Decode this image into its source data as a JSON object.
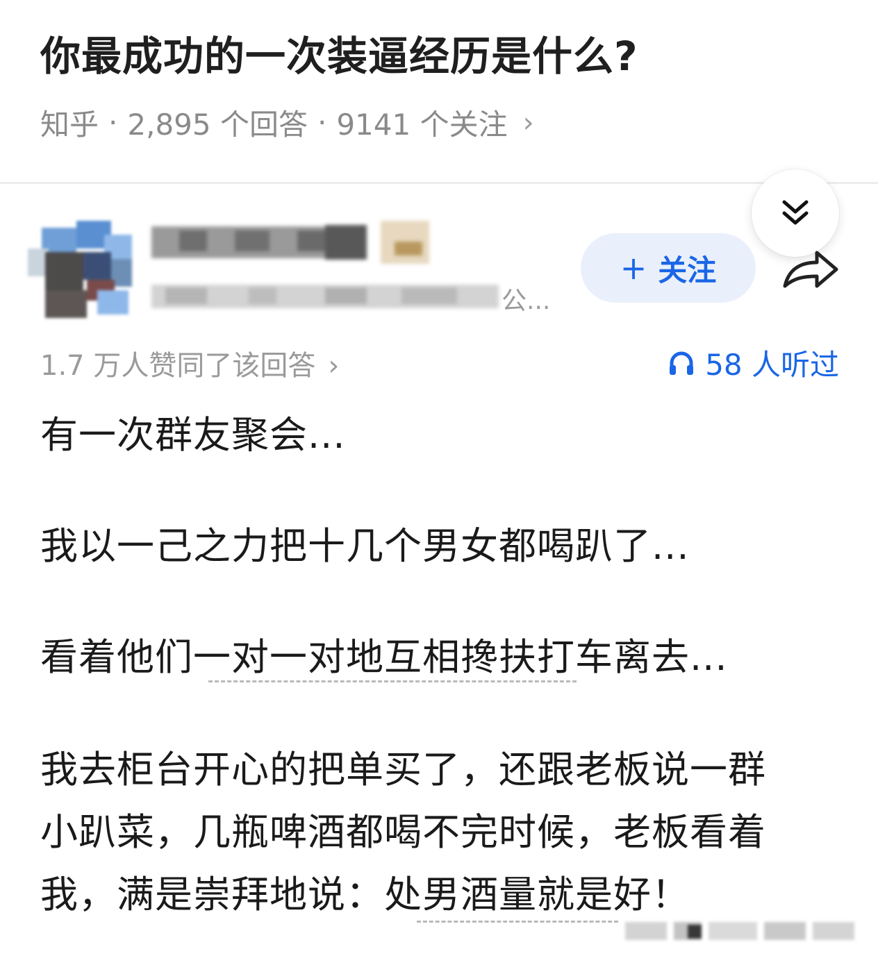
{
  "question": {
    "title": "你最成功的一次装逼经历是什么?",
    "source": "知乎",
    "answers": "2,895 个回答",
    "followers": "9141 个关注",
    "separator": "·"
  },
  "author": {
    "name": "[blurred]",
    "subtitle_tail": "公..."
  },
  "follow_button": {
    "plus": "+",
    "label": "关注"
  },
  "answer_meta": {
    "votes": "1.7 万人赞同了该回答",
    "listened": "58 人听过"
  },
  "answer": {
    "p1": "有一次群友聚会...",
    "p2": "我以一己之力把十几个男女都喝趴了...",
    "p3": "看着他们一对一对地互相搀扶打车离去...",
    "p4_l1": "我去柜台开心的把单买了，还跟老板说一群",
    "p4_l2": "小趴菜，几瓶啤酒都喝不完时候，老板看着",
    "p4_l3": "我，满是崇拜地说：处男酒量就是好！"
  },
  "icons": {
    "chevron": "chevron-right-icon",
    "collapse": "double-chevron-down-icon",
    "share": "share-arrow-icon",
    "headphones": "headphones-icon"
  },
  "colors": {
    "accent": "#1a66e6",
    "follow_bg": "#eaf0fb",
    "meta_gray": "#8a8a8a"
  }
}
